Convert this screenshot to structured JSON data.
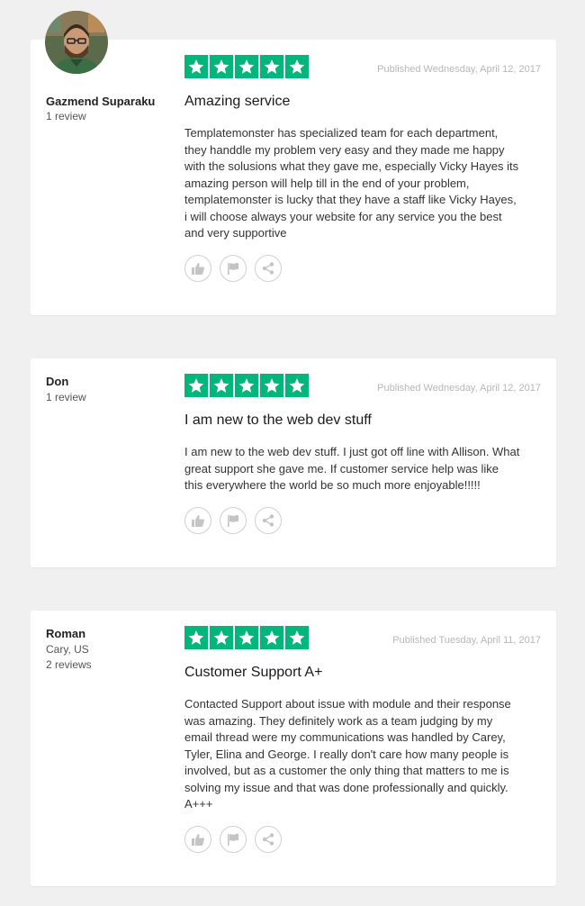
{
  "reviews": [
    {
      "author": "Gazmend Suparaku",
      "location": "",
      "review_count": "1 review",
      "rating": 5,
      "published": "Published Wednesday, April 12, 2017",
      "title": "Amazing service",
      "body": "Templatemonster has specialized team for each department,\nthey handdle my problem very easy and they made me happy\nwith the solusions what they gave me, especially Vicky Hayes its\namazing person will help till in the end of your problem,\ntemplatemonster is lucky that they have a staff like Vicky Hayes,\ni will choose always your website for any service you the best\nand very supportive"
    },
    {
      "author": "Don",
      "location": "",
      "review_count": "1 review",
      "rating": 5,
      "published": "Published Wednesday, April 12, 2017",
      "title": "I am new to the web dev stuff",
      "body": "I am new to the web dev stuff. I just got off line with Allison. What\ngreat support she gave me. If customer service help was like\nthis everywhere the world be so much more enjoyable!!!!!"
    },
    {
      "author": "Roman",
      "location": "Cary, US",
      "review_count": "2 reviews",
      "rating": 5,
      "published": "Published Tuesday, April 11, 2017",
      "title": "Customer Support A+",
      "body": "Contacted Support about issue with module and their response\nwas amazing. They definitely work as a team judging by my\nemail thread were my communications was handled by Carey,\nTyler, Elina and George. I really don't care how many people is\ninvolved, but as a customer the only thing that matters to me is\nsolving my issue and that was done professionally and quickly.\nA+++"
    }
  ],
  "colors": {
    "star_bg": "#00b67a",
    "page_bg": "#f0f0f0",
    "published_text": "#b7b7b7"
  },
  "icons": {
    "like": "thumbs-up-icon",
    "flag": "flag-icon",
    "share": "share-icon",
    "star": "star-icon"
  }
}
